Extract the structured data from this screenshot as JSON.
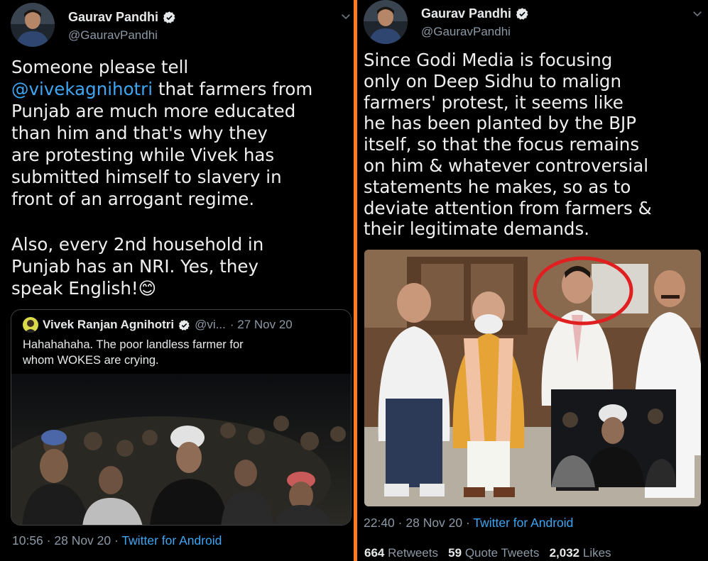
{
  "left_tweet": {
    "author_name": "Gaurav Pandhi",
    "author_handle": "@GauravPandhi",
    "mention": "@vivekagnihotri",
    "text_line1": "Someone please tell",
    "text_after_mention": " that farmers from",
    "text_rest": "Punjab are much more educated\nthan him and that's why they\nare protesting while Vivek has\nsubmitted himself to slavery in\nfront of an arrogant regime.",
    "text_para2": "Also, every 2nd household in\nPunjab has an NRI. Yes, they\nspeak English!",
    "emoji": "😊",
    "quoted": {
      "author_name": "Vivek Ranjan Agnihotri",
      "author_handle": "@vi...",
      "date": "· 27 Nov 20",
      "text": "Hahahahaha. The poor landless farmer for\nwhom WOKES are crying."
    },
    "time": "10:56",
    "date": "· 28 Nov 20 ·",
    "source": "Twitter for Android"
  },
  "right_tweet": {
    "author_name": "Gaurav Pandhi",
    "author_handle": "@GauravPandhi",
    "text": "Since Godi Media is focusing\nonly on Deep Sidhu to malign\nfarmers' protest, it seems like\nhe has been planted by the BJP\nitself, so that the focus remains\non him & whatever controversial\nstatements he makes, so as to\ndeviate attention from farmers &\ntheir legitimate demands.",
    "time": "22:40",
    "date": "· 28 Nov 20 ·",
    "source": "Twitter for Android",
    "stats": {
      "retweets_count": "664",
      "retweets_label": "Retweets",
      "quotes_count": "59",
      "quotes_label": "Quote Tweets",
      "likes_count": "2,032",
      "likes_label": "Likes"
    }
  },
  "colors": {
    "background": "#000000",
    "divider": "#ff7a1a",
    "link": "#3ea6f2",
    "muted": "#8b98a5",
    "circle_highlight": "#e02020"
  },
  "icons": {
    "verified": "verified-badge-icon",
    "more": "chevron-down-icon"
  }
}
